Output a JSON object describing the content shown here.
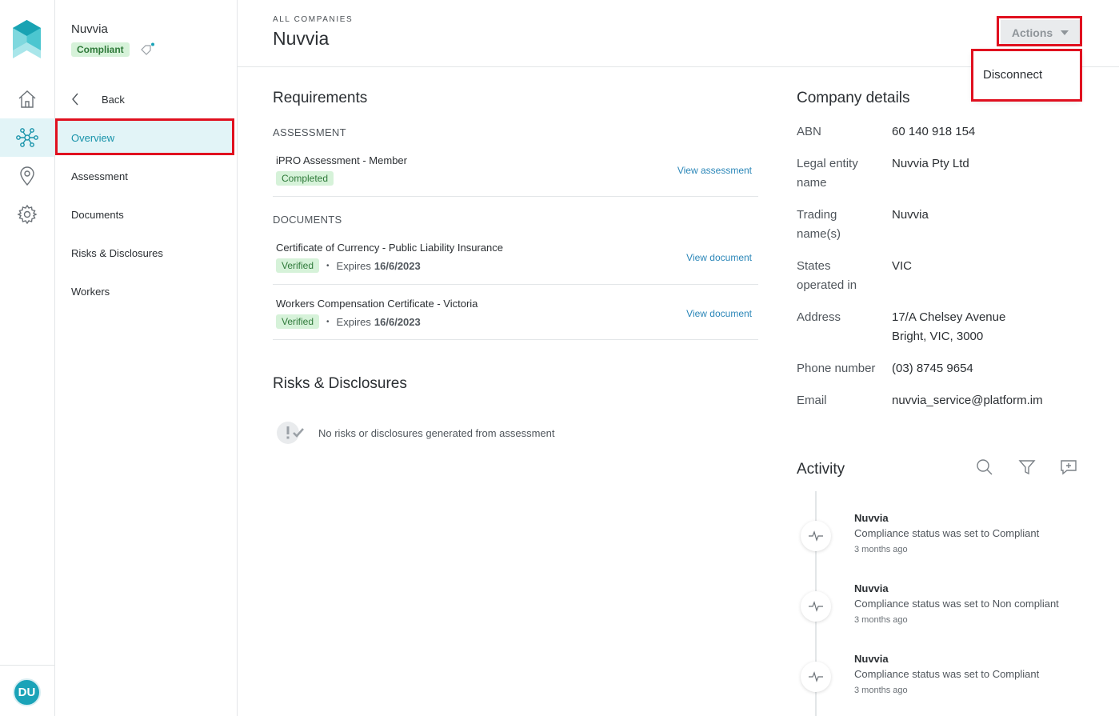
{
  "rail": {
    "avatar_initials": "DU",
    "active_item": "network"
  },
  "subnav": {
    "company_name": "Nuvvia",
    "status": "Compliant",
    "back_label": "Back",
    "items": [
      {
        "label": "Overview",
        "active": true
      },
      {
        "label": "Assessment"
      },
      {
        "label": "Documents"
      },
      {
        "label": "Risks & Disclosures"
      },
      {
        "label": "Workers"
      }
    ]
  },
  "header": {
    "breadcrumb": "ALL COMPANIES",
    "title": "Nuvvia",
    "actions_label": "Actions",
    "actions_menu": [
      "Disconnect"
    ]
  },
  "requirements": {
    "title": "Requirements",
    "assessment_label": "ASSESSMENT",
    "assessment": {
      "name": "iPRO Assessment - Member",
      "status": "Completed",
      "link": "View assessment"
    },
    "documents_label": "DOCUMENTS",
    "documents": [
      {
        "name": "Certificate of Currency - Public Liability Insurance",
        "status": "Verified",
        "expires_prefix": "Expires",
        "expires_date": "16/6/2023",
        "link": "View document"
      },
      {
        "name": "Workers Compensation Certificate - Victoria",
        "status": "Verified",
        "expires_prefix": "Expires",
        "expires_date": "16/6/2023",
        "link": "View document"
      }
    ]
  },
  "risks": {
    "title": "Risks & Disclosures",
    "empty_text": "No risks or disclosures generated from assessment"
  },
  "company_details": {
    "title": "Company details",
    "rows": [
      {
        "key": "ABN",
        "value": "60 140 918 154"
      },
      {
        "key": "Legal entity name",
        "value": "Nuvvia Pty Ltd"
      },
      {
        "key": "Trading name(s)",
        "value": "Nuvvia"
      },
      {
        "key": "States operated in",
        "value": "VIC"
      },
      {
        "key": "Address",
        "value": "17/A Chelsey Avenue\nBright, VIC, 3000"
      },
      {
        "key": "Phone number",
        "value": "(03) 8745 9654"
      },
      {
        "key": "Email",
        "value": "nuvvia_service@platform.im"
      }
    ]
  },
  "activity": {
    "title": "Activity",
    "entries": [
      {
        "who": "Nuvvia",
        "what": "Compliance status was set to Compliant",
        "when": "3 months ago"
      },
      {
        "who": "Nuvvia",
        "what": "Compliance status was set to Non compliant",
        "when": "3 months ago"
      },
      {
        "who": "Nuvvia",
        "what": "Compliance status was set to Compliant",
        "when": "3 months ago"
      }
    ]
  },
  "colors": {
    "accent": "#1aa3b8",
    "highlight": "#e0101f",
    "badge_bg": "#d6f2d9",
    "link": "#2a86b8"
  }
}
